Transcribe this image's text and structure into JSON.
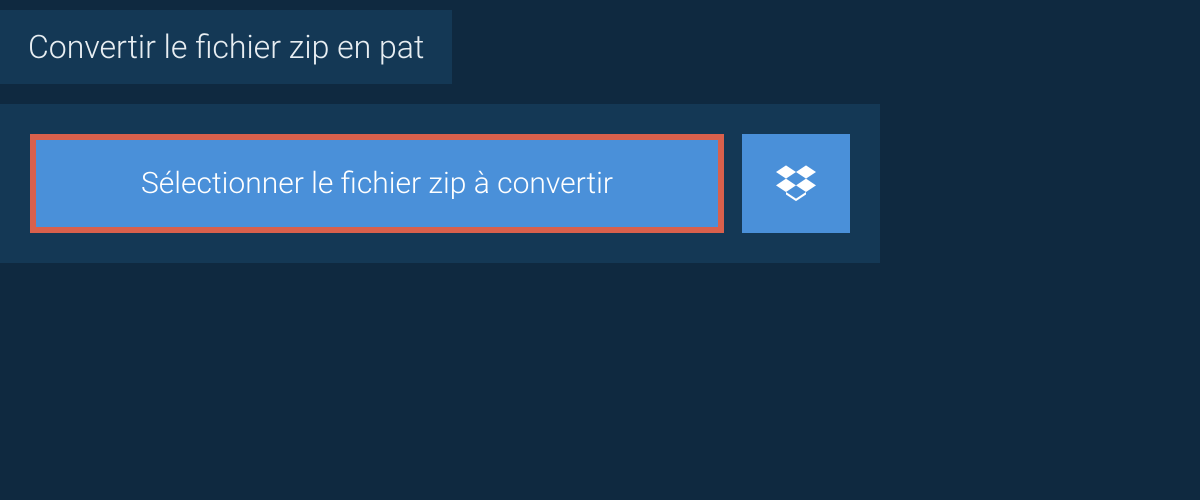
{
  "header": {
    "title": "Convertir le fichier zip en pat"
  },
  "actions": {
    "select_file_label": "Sélectionner le fichier zip à convertir",
    "dropbox_icon": "dropbox"
  },
  "colors": {
    "background": "#0f2940",
    "panel": "#143855",
    "button_primary": "#4a90d9",
    "highlight_border": "#d9604c",
    "text_light": "#e8eef2",
    "text_white": "#ffffff"
  }
}
